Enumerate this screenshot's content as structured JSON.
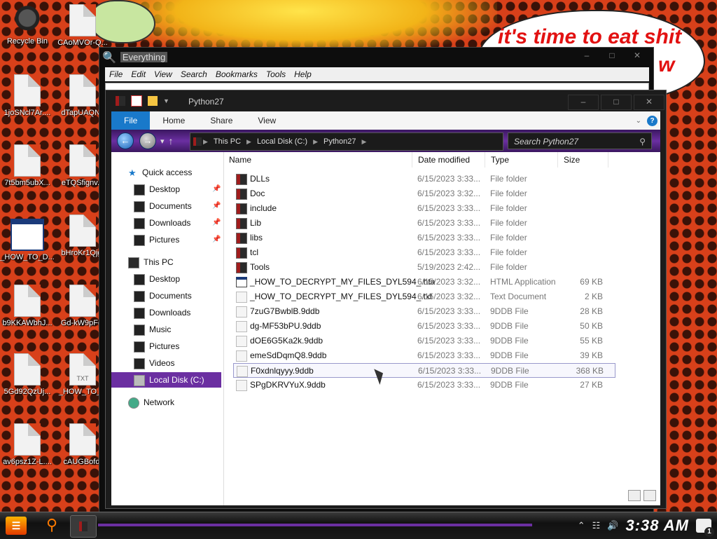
{
  "desktop": {
    "bubble_line1": "it's time to eat shit",
    "bubble_line2": "w",
    "icons": [
      {
        "label": "Recycle Bin"
      },
      {
        "label": "CAoMVOr-Q..."
      },
      {
        "label": "1joSNcl7Ar...."
      },
      {
        "label": "dTapUAQNy"
      },
      {
        "label": "7t5bm5ubX..."
      },
      {
        "label": "eTQSfignv..."
      },
      {
        "label": "_HOW_TO_D..."
      },
      {
        "label": "bHroKr1Qjg."
      },
      {
        "label": "b9KKAWbhJ..."
      },
      {
        "label": "Gd-kW9pFg."
      },
      {
        "label": "5Gd92QzUj..."
      },
      {
        "label": "_HOW_TO_D"
      },
      {
        "label": "av6psz1Z-L...."
      },
      {
        "label": "cAUGBofdt"
      }
    ],
    "txt_badge": "TXT"
  },
  "everything": {
    "title": "Everything",
    "menu": [
      "File",
      "Edit",
      "View",
      "Search",
      "Bookmarks",
      "Tools",
      "Help"
    ]
  },
  "explorer": {
    "title": "Python27",
    "ribbon_tabs": [
      "File",
      "Home",
      "Share",
      "View"
    ],
    "breadcrumb": [
      "This PC",
      "Local Disk (C:)",
      "Python27"
    ],
    "search_placeholder": "Search Python27",
    "nav": {
      "quick_access": "Quick access",
      "qa_items": [
        "Desktop",
        "Documents",
        "Downloads",
        "Pictures"
      ],
      "this_pc": "This PC",
      "pc_items": [
        "Desktop",
        "Documents",
        "Downloads",
        "Music",
        "Pictures",
        "Videos"
      ],
      "local_disk": "Local Disk (C:)",
      "network": "Network"
    },
    "columns": {
      "name": "Name",
      "date": "Date modified",
      "type": "Type",
      "size": "Size"
    },
    "files": [
      {
        "name": "DLLs",
        "date": "6/15/2023 3:33...",
        "type": "File folder",
        "size": "",
        "icon": "folder"
      },
      {
        "name": "Doc",
        "date": "6/15/2023 3:32...",
        "type": "File folder",
        "size": "",
        "icon": "folder"
      },
      {
        "name": "include",
        "date": "6/15/2023 3:33...",
        "type": "File folder",
        "size": "",
        "icon": "folder"
      },
      {
        "name": "Lib",
        "date": "6/15/2023 3:33...",
        "type": "File folder",
        "size": "",
        "icon": "folder"
      },
      {
        "name": "libs",
        "date": "6/15/2023 3:33...",
        "type": "File folder",
        "size": "",
        "icon": "folder"
      },
      {
        "name": "tcl",
        "date": "6/15/2023 3:33...",
        "type": "File folder",
        "size": "",
        "icon": "folder"
      },
      {
        "name": "Tools",
        "date": "5/19/2023 2:42...",
        "type": "File folder",
        "size": "",
        "icon": "folder"
      },
      {
        "name": "_HOW_TO_DECRYPT_MY_FILES_DYL594_.hta",
        "date": "6/15/2023 3:32...",
        "type": "HTML Application",
        "size": "69 KB",
        "icon": "app"
      },
      {
        "name": "_HOW_TO_DECRYPT_MY_FILES_DYL594_.txt",
        "date": "6/15/2023 3:32...",
        "type": "Text Document",
        "size": "2 KB",
        "icon": "doc"
      },
      {
        "name": "7zuG7BwblB.9ddb",
        "date": "6/15/2023 3:33...",
        "type": "9DDB File",
        "size": "28 KB",
        "icon": "doc"
      },
      {
        "name": "dg-MF53bPU.9ddb",
        "date": "6/15/2023 3:33...",
        "type": "9DDB File",
        "size": "50 KB",
        "icon": "doc"
      },
      {
        "name": "dOE6G5Ka2k.9ddb",
        "date": "6/15/2023 3:33...",
        "type": "9DDB File",
        "size": "55 KB",
        "icon": "doc"
      },
      {
        "name": "emeSdDqmQ8.9ddb",
        "date": "6/15/2023 3:33...",
        "type": "9DDB File",
        "size": "39 KB",
        "icon": "doc"
      },
      {
        "name": "F0xdnlqyyy.9ddb",
        "date": "6/15/2023 3:33...",
        "type": "9DDB File",
        "size": "368 KB",
        "icon": "doc"
      },
      {
        "name": "SPgDKRVYuX.9ddb",
        "date": "6/15/2023 3:33...",
        "type": "9DDB File",
        "size": "27 KB",
        "icon": "doc"
      }
    ]
  },
  "taskbar": {
    "clock": "3:38 AM",
    "notification_count": "1"
  },
  "colors": {
    "accent": "#6b2fa1",
    "ribbon_file": "#1979ca",
    "desktop": "#d8401a"
  }
}
